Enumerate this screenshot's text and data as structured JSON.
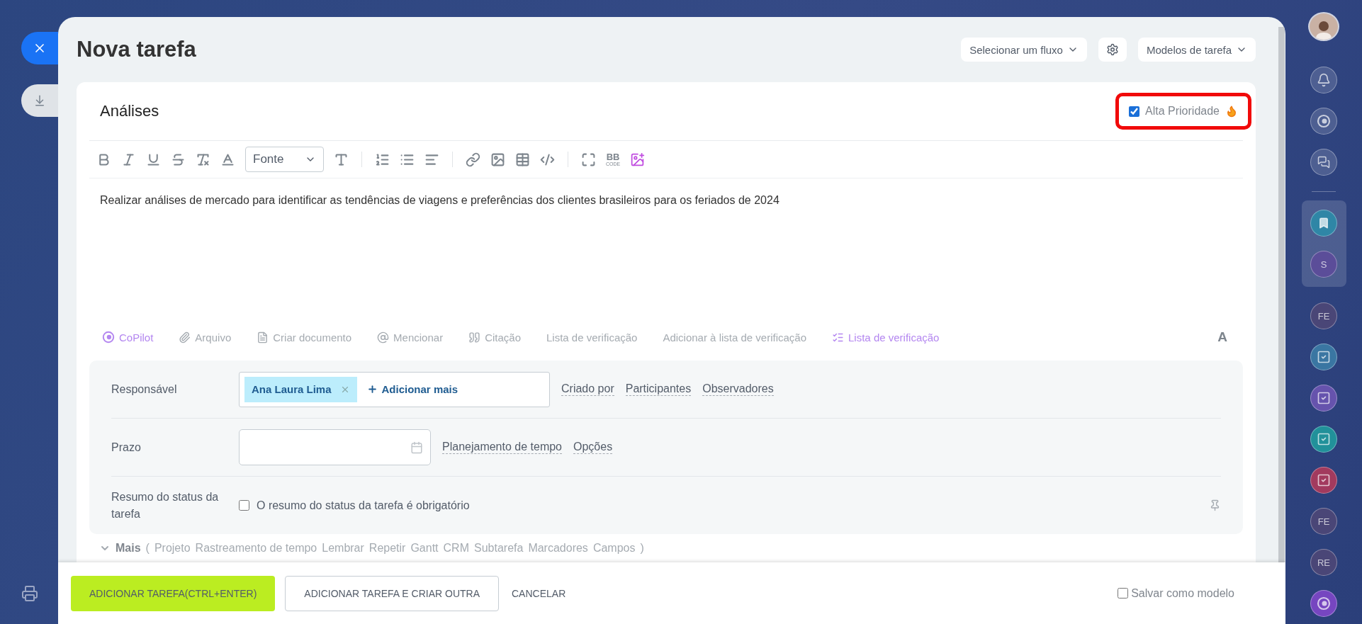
{
  "window": {
    "title": "Nova tarefa"
  },
  "flow_select": {
    "label": "Selecionar um fluxo"
  },
  "templates_select": {
    "label": "Modelos de tarefa"
  },
  "task": {
    "title": "Análises",
    "high_priority": {
      "label": "Alta Prioridade",
      "checked": true,
      "highlighted": true
    }
  },
  "editor": {
    "font_select": "Fonte",
    "bbcode": {
      "title": "BB",
      "caption": "CODE"
    },
    "body": "Realizar análises de mercado para identificar as tendências de viagens e preferências dos clientes brasileiros para os feriados de 2024"
  },
  "actions": [
    {
      "label": "CoPilot",
      "kind": "copilot"
    },
    {
      "label": "Arquivo",
      "kind": "file"
    },
    {
      "label": "Criar documento",
      "kind": "document"
    },
    {
      "label": "Mencionar",
      "kind": "mention"
    },
    {
      "label": "Citação",
      "kind": "quote"
    },
    {
      "label": "Lista de verificação",
      "kind": "text"
    },
    {
      "label": "Adicionar à lista de verificação",
      "kind": "text"
    },
    {
      "label": "Lista de verificação",
      "kind": "aichecklist"
    }
  ],
  "format_toggle": "A",
  "fields": [
    {
      "label": "Responsável",
      "kind": "people",
      "tags": [
        {
          "name": "Ana Laura Lima"
        }
      ],
      "add_label": "Adicionar mais",
      "links": [
        "Criado por",
        "Participantes",
        "Observadores"
      ]
    },
    {
      "label": "Prazo",
      "kind": "date",
      "links": [
        "Planejamento de tempo",
        "Opções"
      ]
    },
    {
      "label": "Resumo do status da tarefa",
      "kind": "checkbox",
      "option": {
        "label": "O resumo do status da tarefa é obrigatório",
        "checked": false
      }
    }
  ],
  "more": {
    "label": "Mais",
    "open": "(",
    "items": [
      "Projeto",
      "Rastreamento de tempo",
      "Lembrar",
      "Repetir",
      "Gantt",
      "CRM",
      "Subtarefa",
      "Marcadores",
      "Campos"
    ],
    "close": ")"
  },
  "footer": {
    "buttons": [
      {
        "label": "ADICIONAR TAREFA(CTRL+ENTER)",
        "kind": "primary"
      },
      {
        "label": "ADICIONAR TAREFA E CRIAR OUTRA",
        "kind": "secondary"
      },
      {
        "label": "CANCELAR",
        "kind": "link"
      }
    ],
    "save_template": {
      "label": "Salvar como modelo",
      "checked": false
    }
  },
  "right_bar": [
    {
      "kind": "avatar"
    },
    {
      "kind": "bell"
    },
    {
      "kind": "copilot"
    },
    {
      "kind": "chat"
    },
    {
      "kind": "divider"
    },
    {
      "kind": "pinned",
      "items": [
        {
          "kind": "bookmark",
          "color": "#2f86a6"
        },
        {
          "kind": "initials",
          "text": "S",
          "color": "#5b4d99"
        }
      ]
    },
    {
      "kind": "initials",
      "text": "FE",
      "color": "#4a4677"
    },
    {
      "kind": "task",
      "color": "#3a76a2"
    },
    {
      "kind": "task",
      "color": "#6653ad"
    },
    {
      "kind": "task",
      "color": "#21919a"
    },
    {
      "kind": "task",
      "color": "#a23a5e"
    },
    {
      "kind": "initials",
      "text": "FE",
      "color": "#4a4677"
    },
    {
      "kind": "initials",
      "text": "RE",
      "color": "#4a4677"
    },
    {
      "kind": "copilot-app",
      "color": "#7646c0"
    }
  ]
}
